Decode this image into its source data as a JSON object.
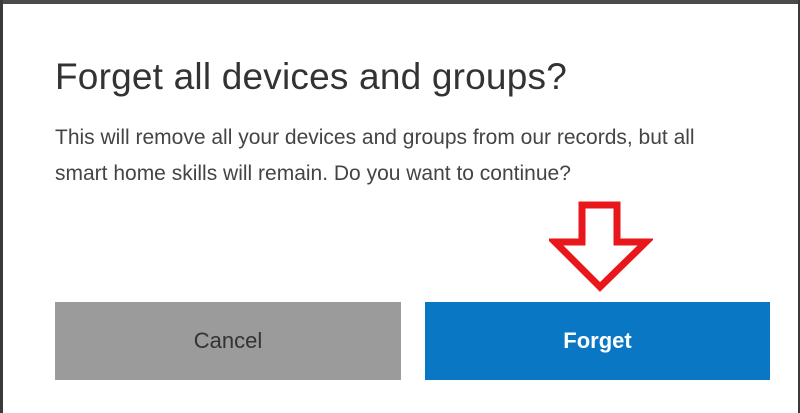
{
  "dialog": {
    "title": "Forget all devices and groups?",
    "message": "This will remove all your devices and groups from our records, but all smart home skills will remain. Do you want to continue?",
    "cancel_label": "Cancel",
    "forget_label": "Forget"
  },
  "annotation": {
    "icon": "down-arrow-icon",
    "color": "#e8171c"
  },
  "colors": {
    "cancel_button": "#9b9b9b",
    "forget_button": "#0a77c4",
    "frame": "#3a3a3a"
  }
}
